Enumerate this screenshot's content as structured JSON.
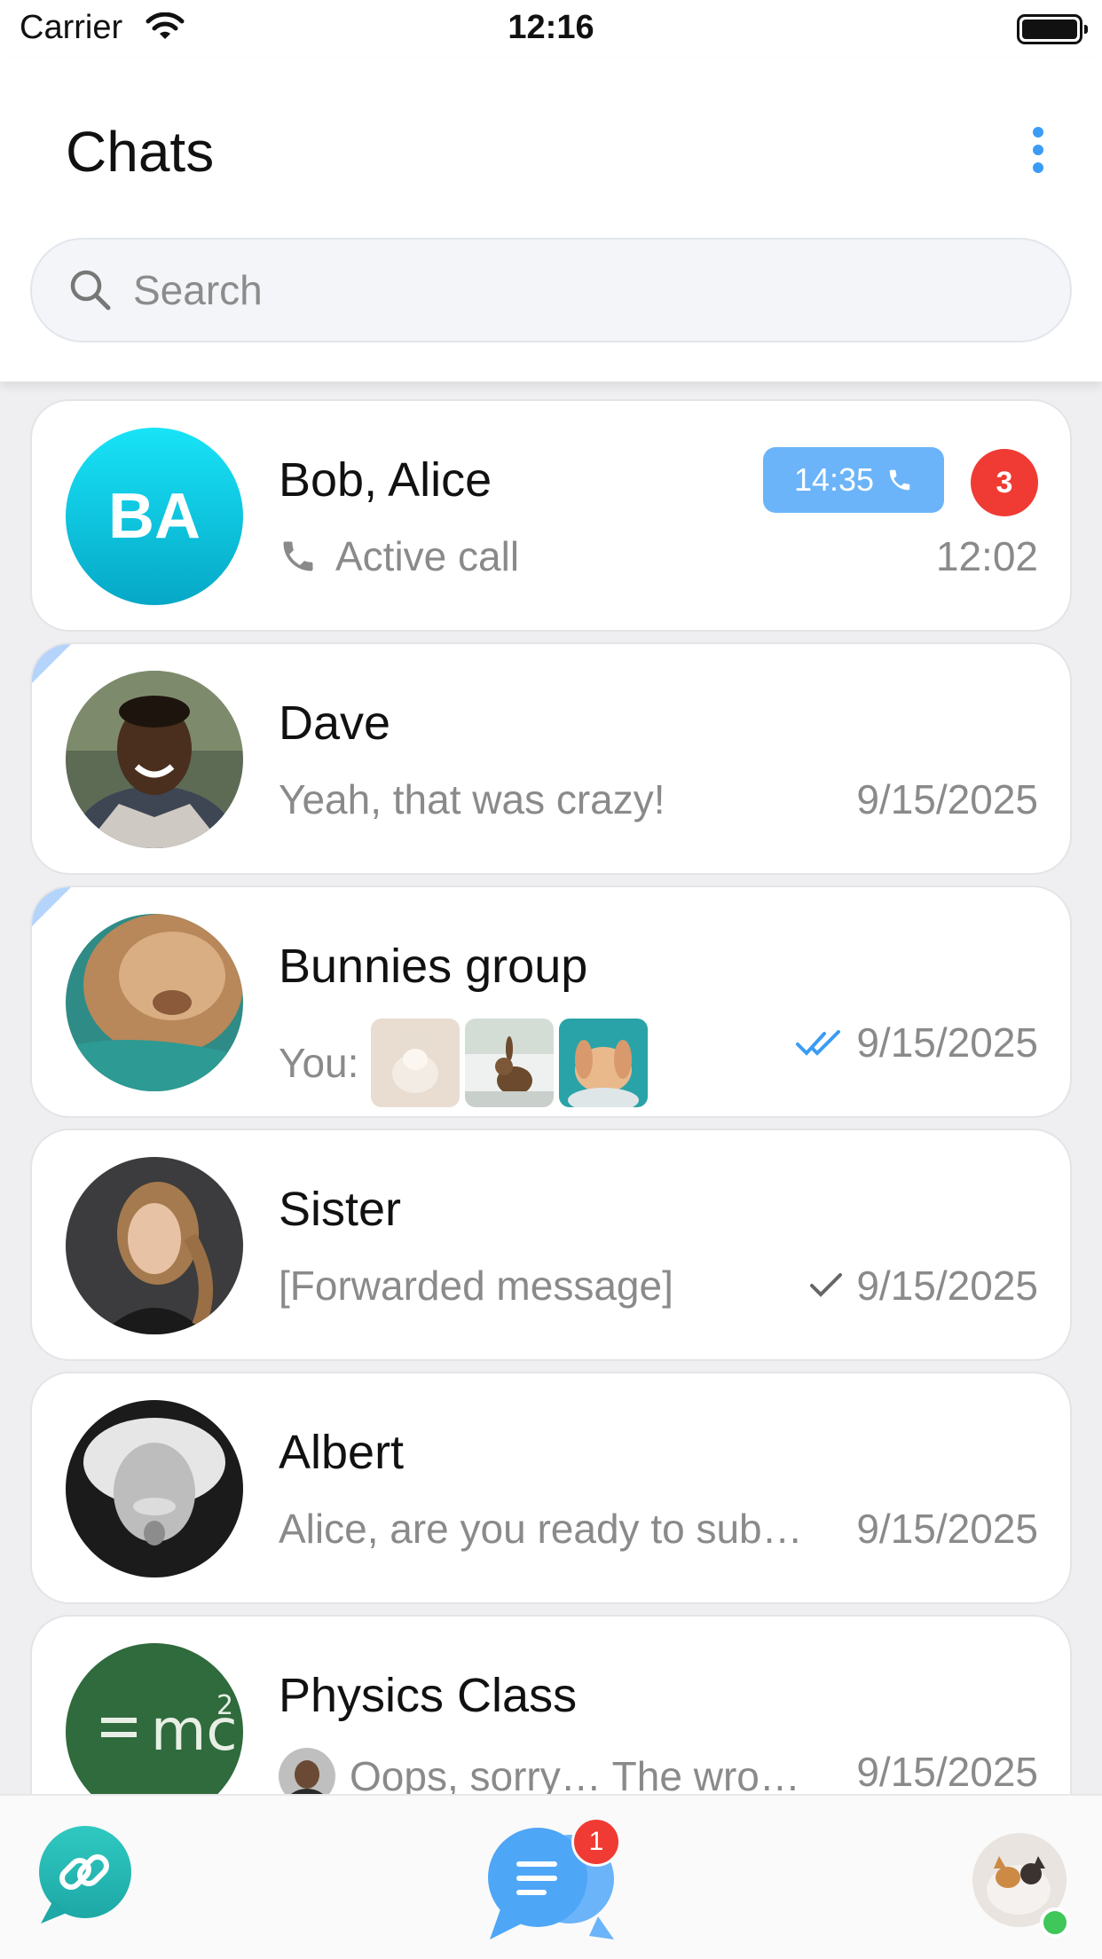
{
  "status_bar": {
    "carrier": "Carrier",
    "time": "12:16"
  },
  "header": {
    "title": "Chats",
    "more_icon": "more-vertical-icon"
  },
  "search": {
    "placeholder": "Search",
    "icon": "search-icon"
  },
  "chats": [
    {
      "name": "Bob, Alice",
      "initials": "BA",
      "preview": "Active call",
      "time": "12:02",
      "call_duration": "14:35",
      "unread": "3"
    },
    {
      "name": "Dave",
      "preview": "Yeah, that was crazy!",
      "time": "9/15/2025"
    },
    {
      "name": "Bunnies group",
      "preview": "You:",
      "time": "9/15/2025",
      "status": "read"
    },
    {
      "name": "Sister",
      "preview": "[Forwarded message]",
      "time": "9/15/2025",
      "status": "sent"
    },
    {
      "name": "Albert",
      "preview": "Alice, are you ready to sub…",
      "time": "9/15/2025"
    },
    {
      "name": "Physics Class",
      "preview": "Oops, sorry… The wro…",
      "time": "9/15/2025"
    }
  ],
  "bottom_nav": {
    "chats_badge": "1"
  },
  "colors": {
    "accent": "#3b9cf5",
    "badge": "#ef3b33",
    "online": "#3fc75a",
    "call": "#6bb4f9"
  }
}
